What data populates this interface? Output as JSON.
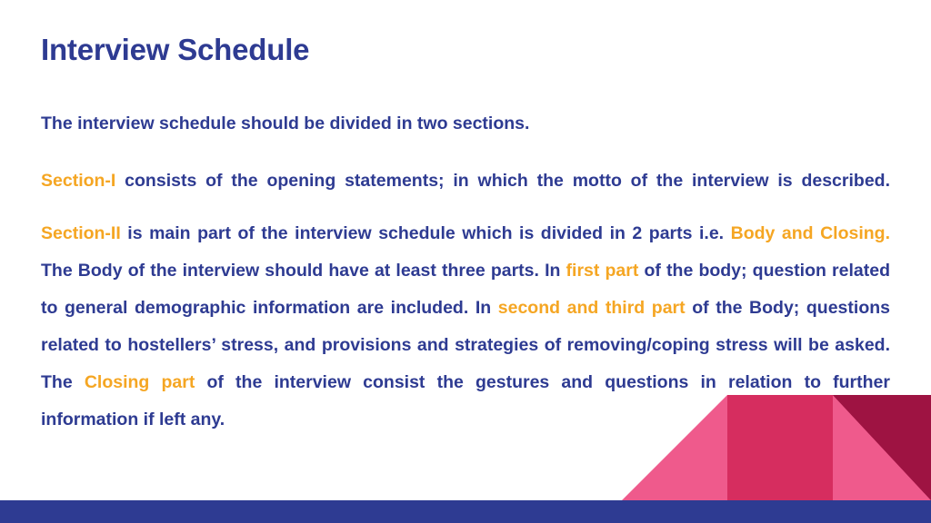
{
  "slide": {
    "title": "Interview Schedule",
    "colors": {
      "title_blue": "#2e3b92",
      "body_blue": "#2e3b92",
      "highlight_orange": "#f5a623",
      "bar_blue": "#2e3b92",
      "decor_pink_light": "#ef5a8c",
      "decor_pink_mid": "#d62d5f",
      "decor_maroon": "#9e1342",
      "background": "#ffffff"
    },
    "paragraphs": {
      "intro": "The interview schedule should be divided in two sections.",
      "section_one": {
        "label": "Section-I",
        "rest": " consists of the opening statements; in which the motto of the interview is described."
      },
      "section_two": {
        "label": "Section-II",
        "seg_1": " is main part of the interview schedule which is divided in 2 parts i.e. ",
        "hl_body_closing": "Body and Closing.",
        "seg_2": " The Body of the interview should have at least three parts. In ",
        "hl_first_part": "first part",
        "seg_3": " of the body; question related to general demographic information are included. In ",
        "hl_second_third": "second and third part",
        "seg_4": " of the Body; questions related to hostellers’ stress, and provisions and strategies of removing/coping stress will be asked. The ",
        "hl_closing_part": "Closing part",
        "seg_5": " of the interview consist the gestures and questions in relation to further information if left any."
      }
    }
  }
}
